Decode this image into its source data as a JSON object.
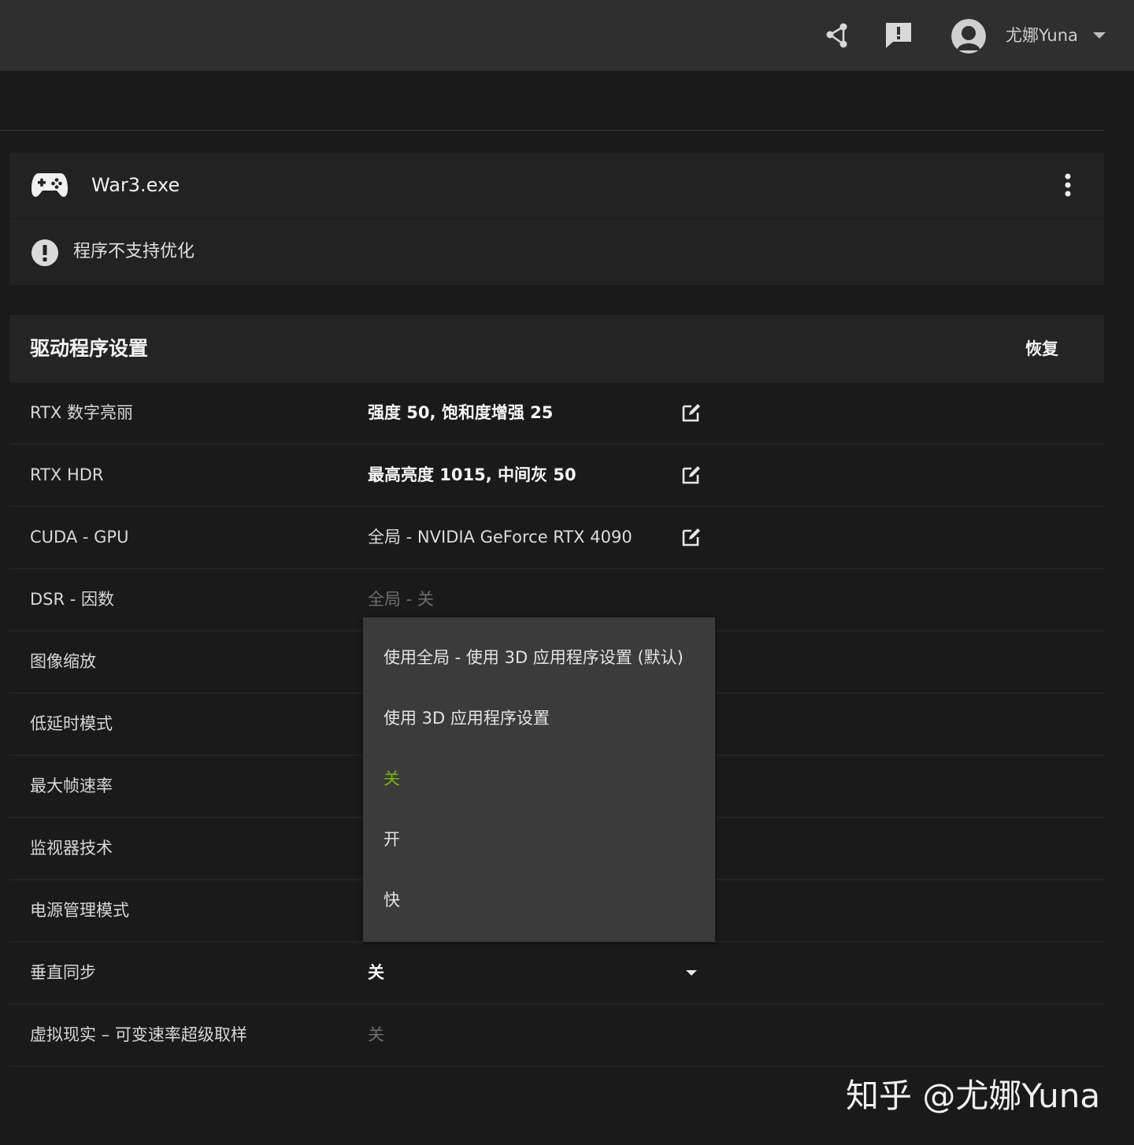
{
  "topbar": {
    "username": "尤娜Yuna",
    "icons": [
      "share-icon",
      "feedback-icon",
      "avatar",
      "chevron-down-icon"
    ]
  },
  "app": {
    "name": "War3.exe",
    "warning": "程序不支持优化",
    "icons": [
      "gamepad-icon",
      "more-vert-icon",
      "warning-icon"
    ]
  },
  "settings": {
    "title": "驱动程序设置",
    "restore_label": "恢复",
    "rows": [
      {
        "label": "RTX 数字亮丽",
        "value": "强度 50, 饱和度增强 25"
      },
      {
        "label": "RTX HDR",
        "value": "最高亮度 1015, 中间灰 50"
      },
      {
        "label": "CUDA - GPU",
        "value": "全局 - NVIDIA GeForce RTX 4090"
      },
      {
        "label": "DSR - 因数",
        "value": "全局 - 关"
      },
      {
        "label": "图像缩放",
        "value": ""
      },
      {
        "label": "低延时模式",
        "value": ""
      },
      {
        "label": "最大帧速率",
        "value": ""
      },
      {
        "label": "监视器技术",
        "value": ""
      },
      {
        "label": "电源管理模式",
        "value": ""
      },
      {
        "label": "垂直同步",
        "value": "关"
      },
      {
        "label": "虚拟现实 – 可变速率超级取样",
        "value": "关"
      }
    ]
  },
  "dropdown": {
    "options": [
      "使用全局 - 使用 3D 应用程序设置 (默认)",
      "使用 3D 应用程序设置",
      "关",
      "开",
      "快"
    ],
    "selected_index": 2
  },
  "colors": {
    "accent": "#76b900",
    "background": "#1a1a1a",
    "topbar": "#2f2f2f",
    "dropdown": "#3b3b3b"
  },
  "watermark": "知乎 @尤娜Yuna"
}
